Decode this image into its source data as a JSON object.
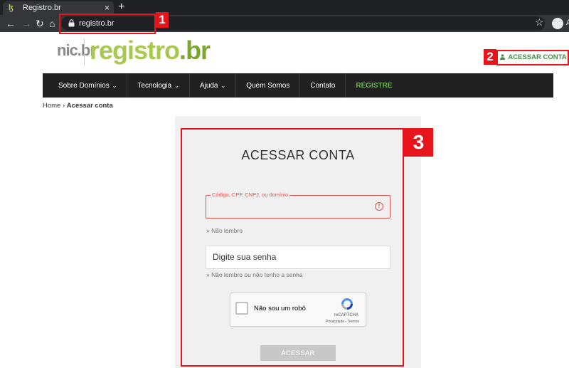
{
  "browser": {
    "tab_title": "Registro.br",
    "tab_close": "×",
    "new_tab": "+",
    "url": "registro.br",
    "profile_letter": "A"
  },
  "annotations": [
    "1",
    "2",
    "3"
  ],
  "site": {
    "logo_nic": "nic.br",
    "logo_registro": "registro",
    "logo_dot": ".",
    "logo_br": "br",
    "login_link": "ACESSAR CONTA",
    "nav": [
      {
        "label": "Sobre Domínios",
        "caret": "⌄"
      },
      {
        "label": "Tecnologia",
        "caret": "⌄"
      },
      {
        "label": "Ajuda",
        "caret": "⌄"
      },
      {
        "label": "Quem Somos"
      },
      {
        "label": "Contato"
      },
      {
        "label": "REGISTRE"
      }
    ],
    "breadcrumb": {
      "home": "Home",
      "sep": "›",
      "current": "Acessar conta"
    }
  },
  "login": {
    "title": "ACESSAR CONTA",
    "user_field_label": "Código, CPF, CNPJ, ou domínio",
    "user_field_value": "",
    "forgot_user": "» Não lembro",
    "password_placeholder": "Digite sua senha",
    "forgot_password": "» Não lembro ou não tenho a senha",
    "captcha_text": "Não sou um robô",
    "captcha_brand": "reCAPTCHA",
    "captcha_links": "Privacidade - Termos",
    "submit": "ACESSAR"
  },
  "colors": {
    "annotation": "#e8141c",
    "brand_green": "#a9c84f",
    "nav_bg": "#212121",
    "registre": "#6ab04c",
    "error": "#d9534f"
  }
}
